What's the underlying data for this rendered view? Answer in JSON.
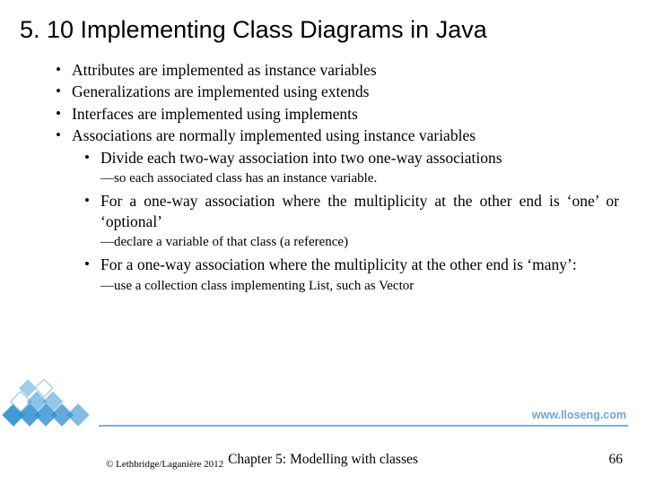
{
  "title": "5. 10 Implementing Class Diagrams in Java",
  "bullets": {
    "b1": "Attributes are implemented as instance variables",
    "b2": "Generalizations are implemented using extends",
    "b3": "Interfaces are implemented using implements",
    "b4": "Associations are normally implemented using instance variables",
    "s1": "Divide each two-way association into two one-way associations",
    "n1": "—so each associated class has an instance variable.",
    "s2": "For a one-way association where the multiplicity at the other end is ‘one’ or ‘optional’",
    "n2": "—declare a variable of that class (a reference)",
    "s3": "For a one-way association where the multiplicity at the other end is ‘many’:",
    "n3": "—use a collection class implementing List, such as Vector"
  },
  "url": "www.lloseng.com",
  "copyright": "© Lethbridge/Laganière 2012",
  "chapter": "Chapter 5: Modelling with classes",
  "page": "66"
}
